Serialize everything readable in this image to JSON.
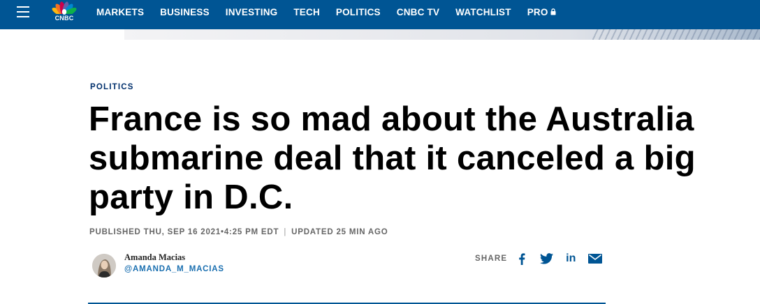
{
  "nav": {
    "logo_text": "CNBC",
    "items": [
      {
        "label": "MARKETS"
      },
      {
        "label": "BUSINESS"
      },
      {
        "label": "INVESTING"
      },
      {
        "label": "TECH"
      },
      {
        "label": "POLITICS"
      },
      {
        "label": "CNBC TV"
      },
      {
        "label": "WATCHLIST"
      },
      {
        "label": "PRO"
      }
    ]
  },
  "article": {
    "eyebrow": "POLITICS",
    "headline": "France is so mad about the Australia submarine deal that it canceled a big party in D.C.",
    "published": "PUBLISHED THU, SEP 16 2021•4:25 PM EDT",
    "separator": "|",
    "updated": "UPDATED 25 MIN AGO"
  },
  "author": {
    "name": "Amanda Macias",
    "handle": "@AMANDA_M_MACIAS"
  },
  "share": {
    "label": "SHARE",
    "linkedin_glyph": "in",
    "icons": [
      "facebook-icon",
      "twitter-icon",
      "linkedin-icon",
      "email-icon"
    ]
  },
  "colors": {
    "nav_bg": "#005594",
    "eyebrow": "#002f6c",
    "link": "#1a6fb0",
    "icon": "#005594"
  }
}
